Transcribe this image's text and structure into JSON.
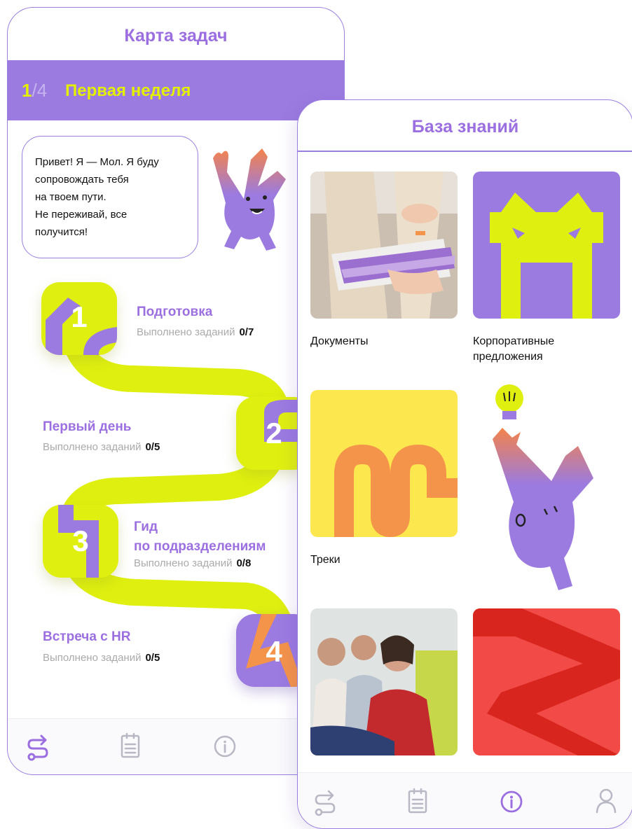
{
  "task_map": {
    "title": "Карта задач",
    "week": {
      "number": "1",
      "total": "/4",
      "name": "Первая неделя"
    },
    "greeting": [
      "Привет! Я — Мол. Я буду",
      "сопровождать тебя",
      "на твоем пути.",
      "Не переживай, все",
      "получится!"
    ],
    "stages": [
      {
        "badge": "1",
        "title": "Подготовка",
        "progress_label": "Выполнено заданий",
        "progress": "0/7"
      },
      {
        "badge": "2",
        "title": "Первый день",
        "progress_label": "Выполнено заданий",
        "progress": "0/5"
      },
      {
        "badge": "3",
        "title_line1": "Гид",
        "title_line2": "по подразделениям",
        "progress_label": "Выполнено заданий",
        "progress": "0/8"
      },
      {
        "badge": "4",
        "title": "Встреча с HR",
        "progress_label": "Выполнено заданий",
        "progress": "0/5"
      }
    ],
    "tabbar": [
      "route-icon",
      "checklist-icon",
      "info-icon"
    ]
  },
  "knowledge_base": {
    "title": "База знаний",
    "items": [
      {
        "label": "Документы"
      },
      {
        "label_line1": "Корпоративные",
        "label_line2": "предложения"
      },
      {
        "label": "Треки"
      }
    ],
    "tabbar": [
      "route-icon",
      "checklist-icon",
      "info-icon",
      "profile-icon"
    ],
    "active_tab": "info-icon"
  },
  "colors": {
    "purple": "#9b7be0",
    "lime": "#e4f000",
    "orange": "#f4934a",
    "red": "#f24a47"
  }
}
